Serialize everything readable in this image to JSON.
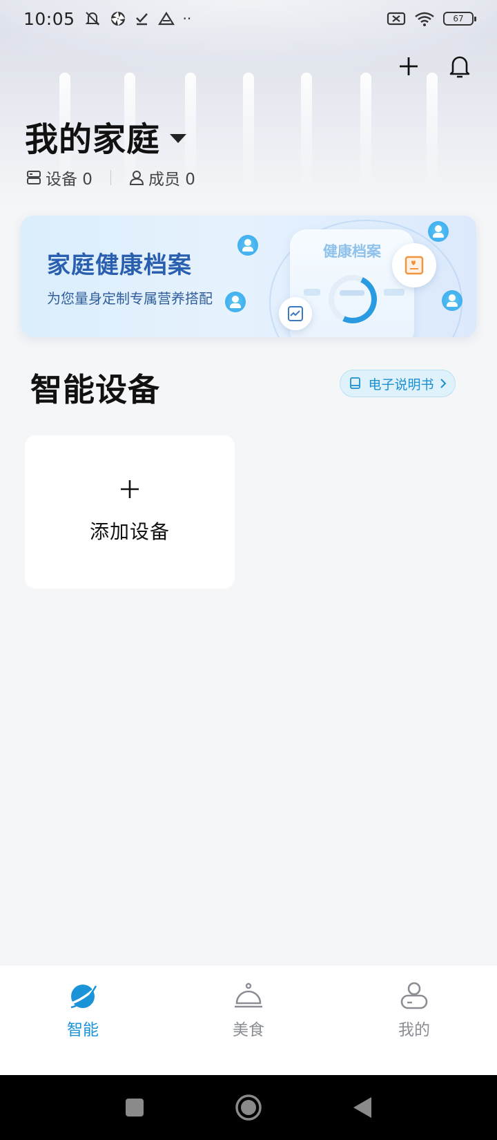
{
  "status_bar": {
    "time": "10:05",
    "battery": "67"
  },
  "home": {
    "title": "我的家庭",
    "devices_label": "设备 0",
    "members_label": "成员 0"
  },
  "banner": {
    "title": "家庭健康档案",
    "subtitle": "为您量身定制专属营养搭配",
    "card_title": "健康档案"
  },
  "section": {
    "title": "智能设备",
    "manual_label": "电子说明书"
  },
  "add_device": {
    "label": "添加设备"
  },
  "bottom_nav": {
    "items": [
      {
        "label": "智能",
        "icon": "planet-icon",
        "active": true
      },
      {
        "label": "美食",
        "icon": "cloche-icon",
        "active": false
      },
      {
        "label": "我的",
        "icon": "profile-icon",
        "active": false
      }
    ]
  },
  "colors": {
    "accent": "#1a93d8",
    "banner_title": "#2a5fb0",
    "background": "#f5f6f8"
  }
}
